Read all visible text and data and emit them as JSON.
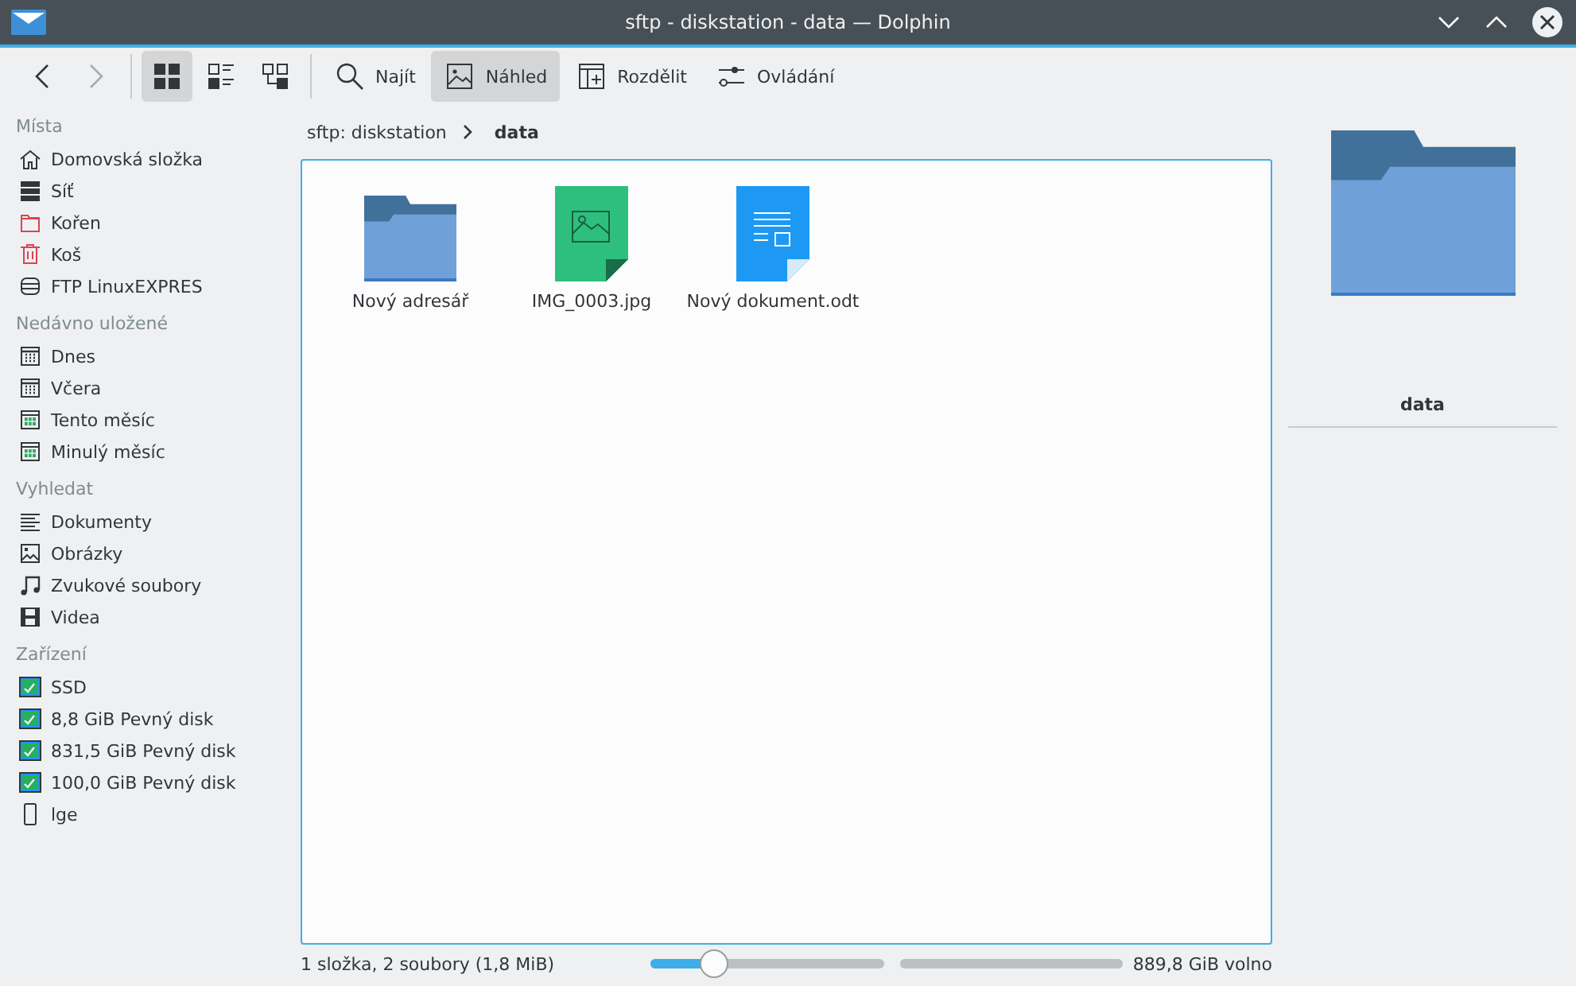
{
  "window": {
    "title": "sftp - diskstation - data — Dolphin"
  },
  "toolbar": {
    "navigation": [
      {
        "kind": "back",
        "disabled": false
      },
      {
        "kind": "forward",
        "disabled": true
      }
    ],
    "view_modes": [
      {
        "kind": "icons",
        "selected": true
      },
      {
        "kind": "compact",
        "selected": false
      },
      {
        "kind": "details",
        "selected": false
      }
    ],
    "actions": [
      {
        "kind": "search",
        "label": "Najít",
        "selected": false
      },
      {
        "kind": "preview",
        "label": "Náhled",
        "selected": true
      },
      {
        "kind": "split",
        "label": "Rozdělit",
        "selected": false
      },
      {
        "kind": "controls",
        "label": "Ovládání",
        "selected": false
      }
    ]
  },
  "sidebar": {
    "sections": [
      {
        "title": "Místa",
        "items": [
          {
            "kind": "home",
            "label": "Domovská složka"
          },
          {
            "kind": "network",
            "label": "Síť"
          },
          {
            "kind": "root",
            "label": "Kořen"
          },
          {
            "kind": "trash",
            "label": "Koš"
          },
          {
            "kind": "database",
            "label": "FTP LinuxEXPRES"
          }
        ]
      },
      {
        "title": "Nedávno uložené",
        "items": [
          {
            "kind": "calendar",
            "label": "Dnes"
          },
          {
            "kind": "calendar",
            "label": "Včera"
          },
          {
            "kind": "calendar-green",
            "label": "Tento měsíc"
          },
          {
            "kind": "calendar-green",
            "label": "Minulý měsíc"
          }
        ]
      },
      {
        "title": "Vyhledat",
        "items": [
          {
            "kind": "documents",
            "label": "Dokumenty"
          },
          {
            "kind": "images",
            "label": "Obrázky"
          },
          {
            "kind": "audio",
            "label": "Zvukové soubory"
          },
          {
            "kind": "video",
            "label": "Videa"
          }
        ]
      },
      {
        "title": "Zařízení",
        "items": [
          {
            "kind": "drive",
            "label": "SSD"
          },
          {
            "kind": "drive",
            "label": "8,8 GiB Pevný disk"
          },
          {
            "kind": "drive",
            "label": "831,5 GiB Pevný disk"
          },
          {
            "kind": "drive",
            "label": "100,0 GiB Pevný disk"
          },
          {
            "kind": "phone",
            "label": "lge"
          }
        ]
      }
    ]
  },
  "breadcrumb": [
    "sftp: diskstation",
    "data"
  ],
  "files": [
    {
      "kind": "folder",
      "name": "Nový adresář"
    },
    {
      "kind": "image",
      "name": "IMG_0003.jpg"
    },
    {
      "kind": "document",
      "name": "Nový dokument.odt"
    }
  ],
  "preview": {
    "kind": "folder",
    "name": "data"
  },
  "status_bar": {
    "summary": "1 složka, 2 soubory (1,8 MiB)",
    "zoom": {
      "level": 0.27
    },
    "free_space": {
      "level": 1,
      "reading": "889,8 GiB volno"
    }
  }
}
